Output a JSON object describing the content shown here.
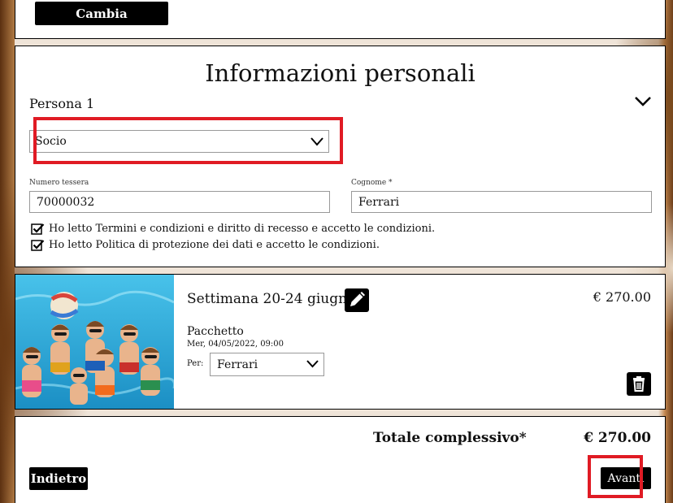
{
  "top": {
    "change_label": "Cambia"
  },
  "personal_info": {
    "title": "Informazioni personali",
    "person_label": "Persona 1",
    "membership_select": {
      "selected": "Socio"
    },
    "card_number": {
      "label": "Numero tessera",
      "value": "70000032"
    },
    "surname": {
      "label": "Cognome *",
      "value": "Ferrari"
    },
    "checkboxes": [
      {
        "label": "Ho letto Termini e condizioni e diritto di recesso e accetto le condizioni.",
        "checked": true
      },
      {
        "label": "Ho letto Politica di protezione dei dati e accetto le condizioni.",
        "checked": true
      }
    ]
  },
  "item": {
    "title": "Settimana 20-24 giugno",
    "price": "€ 270.00",
    "type": "Pacchetto",
    "date": "Mer, 04/05/2022, 09:00",
    "per_label": "Per:",
    "per_selected": "Ferrari"
  },
  "summary": {
    "total_label": "Totale complessivo*",
    "total_value": "€ 270.00",
    "back_label": "Indietro",
    "next_label": "Avanti"
  },
  "colors": {
    "highlight": "#e01b24",
    "button": "#000000",
    "pool": "#2aa6d6"
  }
}
